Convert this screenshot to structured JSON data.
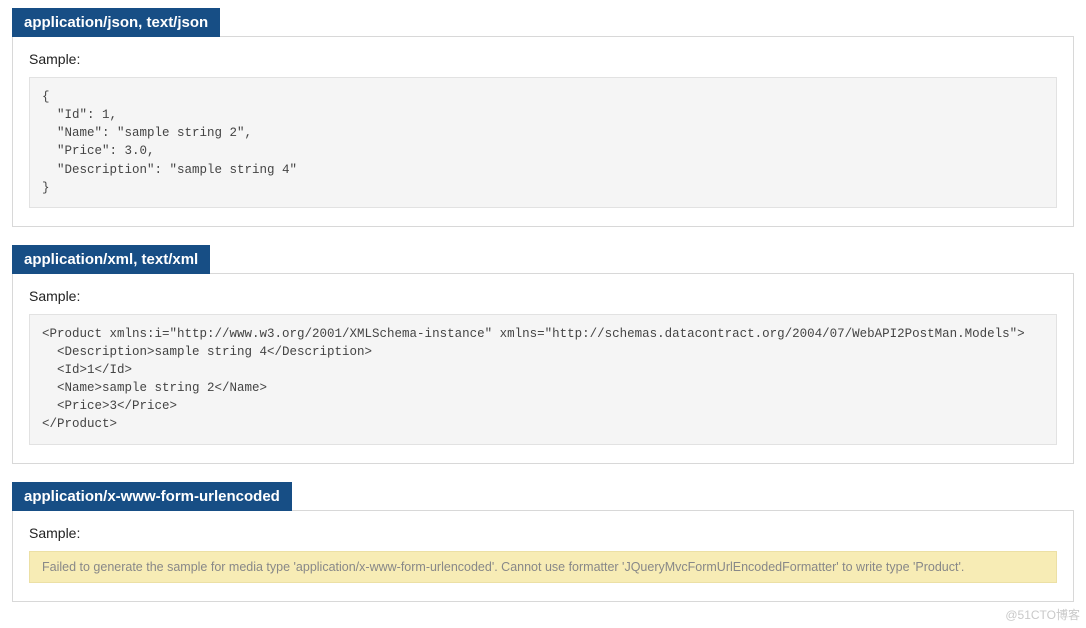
{
  "sections": [
    {
      "title": "application/json, text/json",
      "sample_label": "Sample:",
      "type": "code",
      "content": "{\n  \"Id\": 1,\n  \"Name\": \"sample string 2\",\n  \"Price\": 3.0,\n  \"Description\": \"sample string 4\"\n}"
    },
    {
      "title": "application/xml, text/xml",
      "sample_label": "Sample:",
      "type": "code",
      "content": "<Product xmlns:i=\"http://www.w3.org/2001/XMLSchema-instance\" xmlns=\"http://schemas.datacontract.org/2004/07/WebAPI2PostMan.Models\">\n  <Description>sample string 4</Description>\n  <Id>1</Id>\n  <Name>sample string 2</Name>\n  <Price>3</Price>\n</Product>"
    },
    {
      "title": "application/x-www-form-urlencoded",
      "sample_label": "Sample:",
      "type": "warning",
      "content": "Failed to generate the sample for media type 'application/x-www-form-urlencoded'. Cannot use formatter 'JQueryMvcFormUrlEncodedFormatter' to write type 'Product'."
    }
  ],
  "watermark": "@51CTO博客"
}
